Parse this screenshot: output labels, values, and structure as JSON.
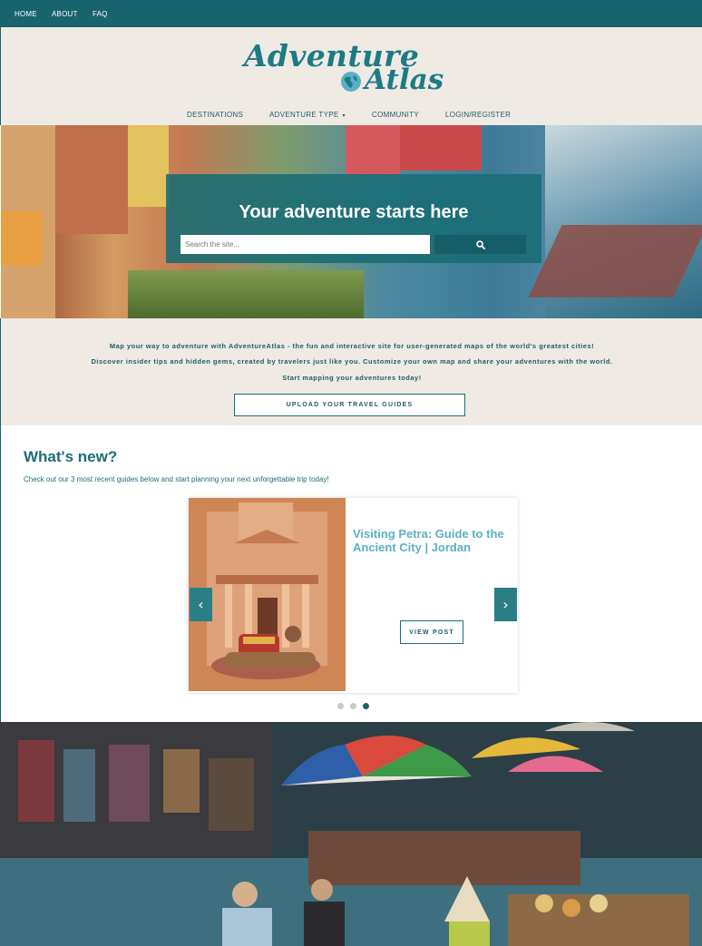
{
  "topnav": {
    "items": [
      "HOME",
      "ABOUT",
      "FAQ"
    ]
  },
  "brand": {
    "line1": "Adventure",
    "line2": "Atlas"
  },
  "mainnav": {
    "items": [
      "DESTINATIONS",
      "ADVENTURE TYPE",
      "COMMUNITY",
      "LOGIN/REGISTER"
    ],
    "dropdown_caret": "▾"
  },
  "hero": {
    "title": "Your adventure starts here",
    "search_placeholder": "Search the site...",
    "search_icon": "search-icon"
  },
  "intro": {
    "line1": "Map your way to adventure with AdventureAtlas - the fun and interactive site for user-generated maps of the world's greatest cities!",
    "line2": "Discover insider tips and hidden gems, created by travelers just like you. Customize your own map and share your adventures with the world.",
    "line3": "Start mapping your adventures today!",
    "upload_button": "UPLOAD YOUR TRAVEL GUIDES"
  },
  "whats_new": {
    "title": "What's new?",
    "subtitle": "Check out our 3 most recent guides below and start planning your next unforgettable trip today!",
    "card": {
      "title": "Visiting Petra: Guide to the Ancient City | Jordan",
      "button": "VIEW POST"
    },
    "prev_arrow": "‹",
    "next_arrow": "›",
    "carousel": {
      "total": 3,
      "active": 3
    }
  },
  "colors": {
    "primary": "#17646f",
    "accent": "#5bb0c6",
    "cream": "#efeae4",
    "dot_inactive": "#c9c9c9"
  }
}
